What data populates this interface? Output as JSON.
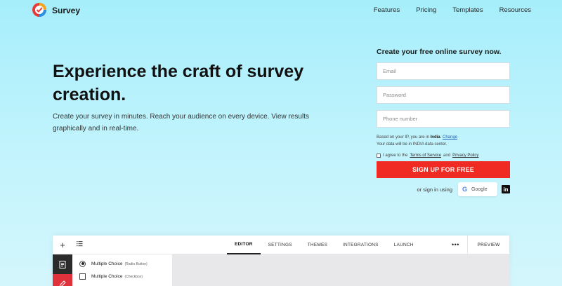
{
  "header": {
    "brand": "Survey",
    "nav": [
      "Features",
      "Pricing",
      "Templates",
      "Resources"
    ]
  },
  "hero": {
    "title": "Experience the craft of survey creation.",
    "subtitle": "Create your survey in minutes. Reach your audience on every device. View results graphically and in real-time."
  },
  "form": {
    "title": "Create your free online survey now.",
    "email_placeholder": "Email",
    "password_placeholder": "Password",
    "phone_placeholder": "Phone number",
    "ip_prefix": "Based on your IP, you are in",
    "country": "India",
    "change_link": "Change",
    "datacenter_note": "Your data will be in INDIA data center.",
    "terms_prefix": "I agree to the",
    "terms_link": "Terms of Service",
    "terms_and": "and",
    "privacy_link": "Privacy Policy",
    "signup_label": "SIGN UP FOR FREE",
    "alt_text": "or sign in using",
    "google_label": "Google",
    "linkedin_glyph": "in"
  },
  "editor": {
    "plus": "+",
    "tabs": [
      "EDITOR",
      "SETTINGS",
      "THEMES",
      "INTEGRATIONS",
      "LAUNCH"
    ],
    "active_tab": "EDITOR",
    "more": "•••",
    "preview": "PREVIEW",
    "questions": [
      {
        "label": "Multiple Choice",
        "type": "(Radio Button)"
      },
      {
        "label": "Multiple Choice",
        "type": "(Checkbox)"
      }
    ]
  },
  "colors": {
    "accent": "#ef2b23",
    "background": "#a6eefb"
  }
}
